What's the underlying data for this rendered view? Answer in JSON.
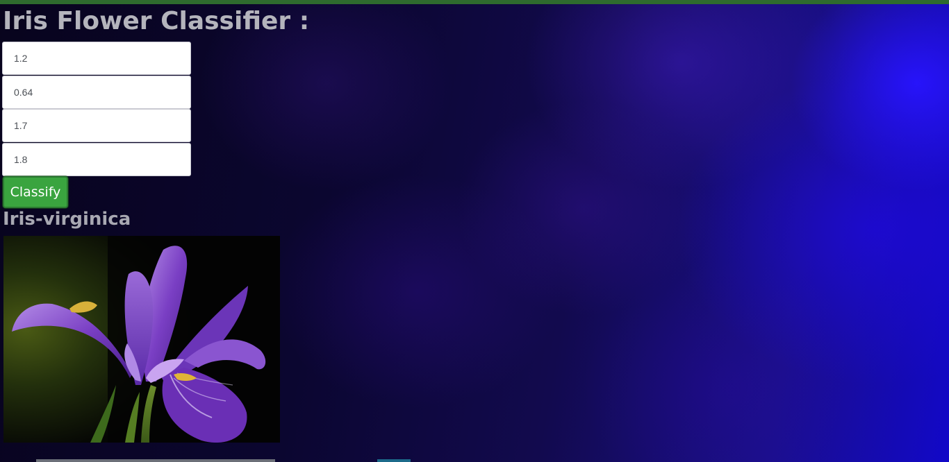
{
  "page": {
    "title": "Iris Flower Classifier :"
  },
  "form": {
    "fields": [
      {
        "value": "1.2"
      },
      {
        "value": "0.64"
      },
      {
        "value": "1.7"
      },
      {
        "value": "1.8"
      }
    ],
    "submit_label": "Classify"
  },
  "result": {
    "prediction": "Iris-virginica",
    "image_subject": "iris-virginica-flower"
  },
  "colors": {
    "accent_button": "#3aa43f",
    "title_text": "#b4b4bc",
    "background_dark": "#0b0630",
    "background_blue": "#1208c8",
    "top_bar": "#2e6b2e"
  }
}
